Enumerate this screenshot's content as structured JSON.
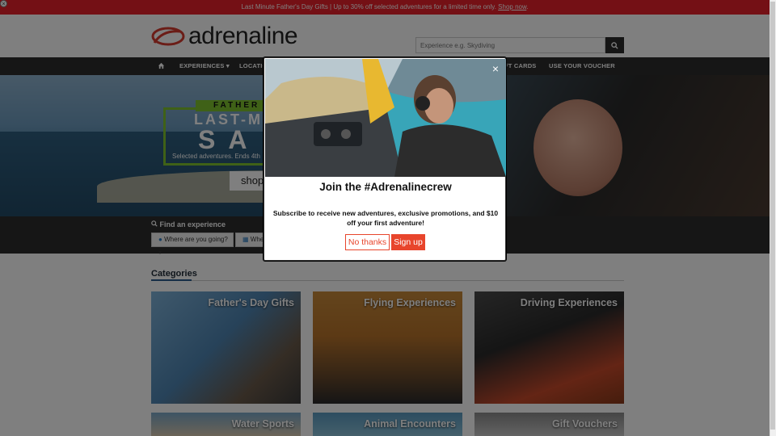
{
  "promo": {
    "text": "Last Minute Father's Day Gifts | Up to 30% off selected adventures for a limited time only. ",
    "link": "Shop now",
    "end": "."
  },
  "header": {
    "logo_text": "adrenaline",
    "search_placeholder": "Experience e.g. Skydiving"
  },
  "nav": {
    "items": [
      "EXPERIENCES",
      "LOCATIONS",
      "GIFT CARDS",
      "USE YOUR VOUCHER"
    ],
    "experiences_label": "EXPERIENCES",
    "locations_label": "LOCATIO",
    "gift_cards_label": "FT CARDS",
    "voucher_label": "USE YOUR VOUCHER"
  },
  "hero": {
    "badge": "FATHER",
    "line1": "LAST-M",
    "line2": "SA",
    "subtitle": "Selected adventures. Ends 4th",
    "shop_label": "shop"
  },
  "find": {
    "title": "Find an experience",
    "where_placeholder": "Where are you going?",
    "when_placeholder": "Whe"
  },
  "categories": {
    "title": "Categories",
    "tiles": [
      {
        "label": "Father's Day Gifts"
      },
      {
        "label": "Flying Experiences"
      },
      {
        "label": "Driving Experiences"
      },
      {
        "label": "Water Sports"
      },
      {
        "label": "Animal Encounters"
      },
      {
        "label": "Gift Vouchers"
      }
    ]
  },
  "modal": {
    "title": "Join the #Adrenalinecrew",
    "text": "Subscribe to receive new adventures, exclusive promotions, and $10 off your first adventure!",
    "no_label": "No thanks",
    "yes_label": "Sign up",
    "close": "×"
  },
  "colors": {
    "promo": "#e8202a",
    "nav": "#2d2d2d",
    "accent": "#e8452c",
    "hero_green": "#7ec22f"
  }
}
